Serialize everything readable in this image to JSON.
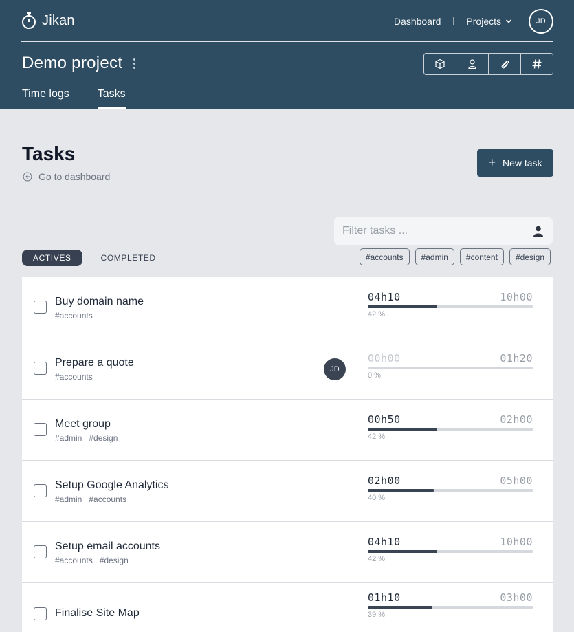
{
  "app": {
    "name": "Jikan"
  },
  "nav": {
    "dashboard": "Dashboard",
    "projects": "Projects",
    "avatar_initials": "JD"
  },
  "project": {
    "title": "Demo project"
  },
  "project_tools": [
    "box-icon",
    "user-icon",
    "paperclip-icon",
    "hash-icon"
  ],
  "tabs": [
    {
      "label": "Time logs",
      "active": false
    },
    {
      "label": "Tasks",
      "active": true
    }
  ],
  "page": {
    "title": "Tasks",
    "back_label": "Go to dashboard",
    "new_task_label": "New task"
  },
  "filter": {
    "placeholder": "Filter tasks ..."
  },
  "status_filter": {
    "active_label": "ACTIVES",
    "completed_label": "COMPLETED"
  },
  "tag_filters": [
    "#accounts",
    "#admin",
    "#content",
    "#design"
  ],
  "colors": {
    "header": "#2e4d63",
    "accent": "#2e4d63",
    "progress": "#3b4452"
  },
  "tasks": [
    {
      "name": "Buy domain name",
      "tags": [
        "#accounts"
      ],
      "assignee": "",
      "spent": "04h10",
      "planned": "10h00",
      "percent": "42 %",
      "progress": 0.42,
      "spent_dim": false
    },
    {
      "name": "Prepare a quote",
      "tags": [
        "#accounts"
      ],
      "assignee": "JD",
      "spent": "00h00",
      "planned": "01h20",
      "percent": "0 %",
      "progress": 0,
      "spent_dim": true
    },
    {
      "name": "Meet group",
      "tags": [
        "#admin",
        "#design"
      ],
      "assignee": "",
      "spent": "00h50",
      "planned": "02h00",
      "percent": "42 %",
      "progress": 0.42,
      "spent_dim": false
    },
    {
      "name": "Setup Google Analytics",
      "tags": [
        "#admin",
        "#accounts"
      ],
      "assignee": "",
      "spent": "02h00",
      "planned": "05h00",
      "percent": "40 %",
      "progress": 0.4,
      "spent_dim": false
    },
    {
      "name": "Setup email accounts",
      "tags": [
        "#accounts",
        "#design"
      ],
      "assignee": "",
      "spent": "04h10",
      "planned": "10h00",
      "percent": "42 %",
      "progress": 0.42,
      "spent_dim": false
    },
    {
      "name": "Finalise Site Map",
      "tags": [],
      "assignee": "",
      "spent": "01h10",
      "planned": "03h00",
      "percent": "39 %",
      "progress": 0.39,
      "spent_dim": false
    }
  ]
}
